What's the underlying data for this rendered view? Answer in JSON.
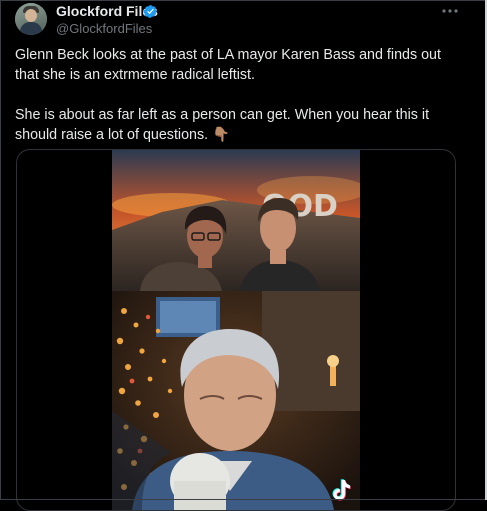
{
  "post": {
    "display_name": "Glockford Files",
    "handle": "@GlockfordFiles",
    "paragraph_1": "Glenn Beck looks at the past of LA mayor Karen Bass and finds out that she is an extrmeme radical leftist.",
    "paragraph_2": "She is about as far left as a person can get. When you hear this it should raise a lot of questions. 👇🏽"
  },
  "video": {
    "sign_text": "OOD"
  },
  "icons": {
    "verified": "verified-badge-icon",
    "more": "more-options-icon",
    "watermark": "tiktok-logo-icon"
  },
  "colors": {
    "background": "#000000",
    "text": "#e7e9ea",
    "muted": "#71767b",
    "verified_blue": "#1d9bf0"
  }
}
